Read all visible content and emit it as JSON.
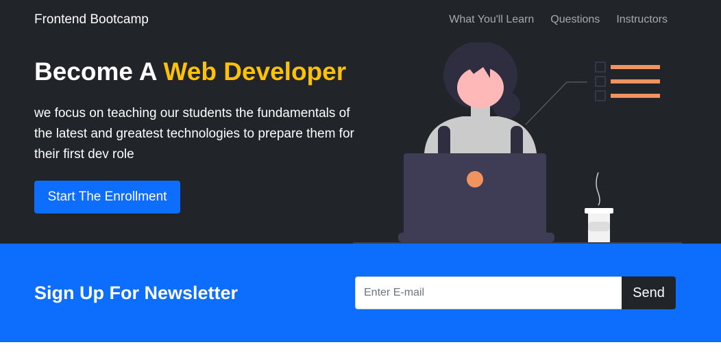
{
  "navbar": {
    "brand": "Frontend Bootcamp",
    "links": [
      {
        "label": "What You'll Learn"
      },
      {
        "label": "Questions"
      },
      {
        "label": "Instructors"
      }
    ]
  },
  "hero": {
    "headline_prefix": "Become A ",
    "headline_accent": "Web Developer",
    "description": "we focus on teaching our students the fundamentals of the latest and greatest technologies to prepare them for their first dev role",
    "cta_label": "Start The Enrollment"
  },
  "newsletter": {
    "title": "Sign Up For Newsletter",
    "email_placeholder": "Enter E-mail",
    "email_value": "",
    "send_label": "Send"
  },
  "colors": {
    "dark": "#212529",
    "primary": "#0d6efd",
    "accent": "#ffc107",
    "illustration_orange": "#f0935e"
  }
}
